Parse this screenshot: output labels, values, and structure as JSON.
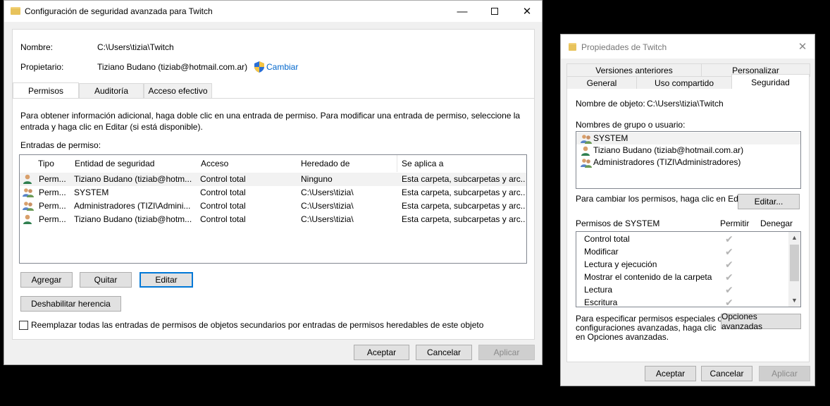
{
  "advanced_window": {
    "title": "Configuración de seguridad avanzada para Twitch",
    "name_label": "Nombre:",
    "name_value": "C:\\Users\\tizia\\Twitch",
    "owner_label": "Propietario:",
    "owner_value": "Tiziano Budano (tiziab@hotmail.com.ar)",
    "change_link": "Cambiar",
    "tabs": [
      "Permisos",
      "Auditoría",
      "Acceso efectivo"
    ],
    "info_line1": "Para obtener información adicional, haga doble clic en una entrada de permiso. Para modificar una entrada de permiso, seleccione la",
    "info_line2": "entrada y haga clic en Editar (si está disponible).",
    "entries_label": "Entradas de permiso:",
    "columns": [
      "Tipo",
      "Entidad de seguridad",
      "Acceso",
      "Heredado de",
      "Se aplica a"
    ],
    "rows": [
      {
        "type": "Perm...",
        "principal": "Tiziano Budano (tiziab@hotm...",
        "access": "Control total",
        "inherited": "Ninguno",
        "applies": "Esta carpeta, subcarpetas y arc...",
        "icon": "user-icon"
      },
      {
        "type": "Perm...",
        "principal": "SYSTEM",
        "access": "Control total",
        "inherited": "C:\\Users\\tizia\\",
        "applies": "Esta carpeta, subcarpetas y arc...",
        "icon": "group-icon"
      },
      {
        "type": "Perm...",
        "principal": "Administradores (TIZI\\Admini...",
        "access": "Control total",
        "inherited": "C:\\Users\\tizia\\",
        "applies": "Esta carpeta, subcarpetas y arc...",
        "icon": "group-icon"
      },
      {
        "type": "Perm...",
        "principal": "Tiziano Budano (tiziab@hotm...",
        "access": "Control total",
        "inherited": "C:\\Users\\tizia\\",
        "applies": "Esta carpeta, subcarpetas y arc...",
        "icon": "user-icon"
      }
    ],
    "btn_add": "Agregar",
    "btn_remove": "Quitar",
    "btn_edit": "Editar",
    "btn_disable_inheritance": "Deshabilitar herencia",
    "replace_checkbox": "Reemplazar todas las entradas de permisos de objetos secundarios por entradas de permisos heredables de este objeto",
    "btn_ok": "Aceptar",
    "btn_cancel": "Cancelar",
    "btn_apply": "Aplicar"
  },
  "props_window": {
    "title": "Propiedades de Twitch",
    "tabs_top": [
      "Versiones anteriores",
      "Personalizar"
    ],
    "tabs_bottom": [
      "General",
      "Uso compartido",
      "Seguridad"
    ],
    "object_label": "Nombre de objeto:",
    "object_value": "C:\\Users\\tizia\\Twitch",
    "groups_label": "Nombres de grupo o usuario:",
    "groups": [
      {
        "name": "SYSTEM",
        "icon": "group-icon"
      },
      {
        "name": "Tiziano Budano (tiziab@hotmail.com.ar)",
        "icon": "user-icon"
      },
      {
        "name": "Administradores (TIZI\\Administradores)",
        "icon": "group-icon"
      }
    ],
    "edit_hint": "Para cambiar los permisos, haga clic en Editar.",
    "btn_edit": "Editar...",
    "perms_label": "Permisos de SYSTEM",
    "allow_label": "Permitir",
    "deny_label": "Denegar",
    "permissions": [
      "Control total",
      "Modificar",
      "Lectura y ejecución",
      "Mostrar el contenido de la carpeta",
      "Lectura",
      "Escritura"
    ],
    "advanced_hint_1": "Para especificar permisos especiales o",
    "advanced_hint_2": "configuraciones avanzadas, haga clic",
    "advanced_hint_3": "en Opciones avanzadas.",
    "btn_advanced": "Opciones avanzadas",
    "btn_ok": "Aceptar",
    "btn_cancel": "Cancelar",
    "btn_apply": "Aplicar"
  }
}
